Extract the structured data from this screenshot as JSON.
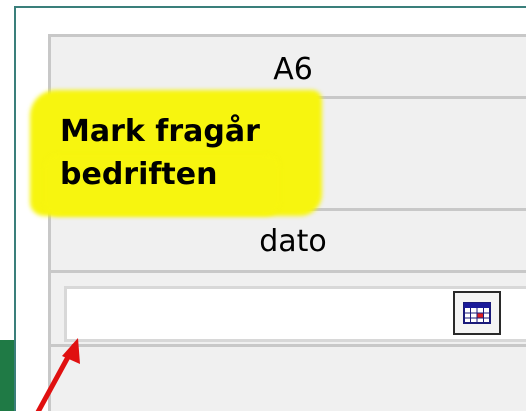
{
  "form": {
    "field_code": "A6",
    "question_line1": "Mark fragår",
    "question_line2": "bedriften",
    "date_label": "dato",
    "date_value": "",
    "calendar_button": "calendar-icon"
  },
  "colors": {
    "highlight": "#f7f50f",
    "frame_border": "#3a7f7b",
    "green_band": "#1f7a45",
    "arrow": "#e01010"
  }
}
